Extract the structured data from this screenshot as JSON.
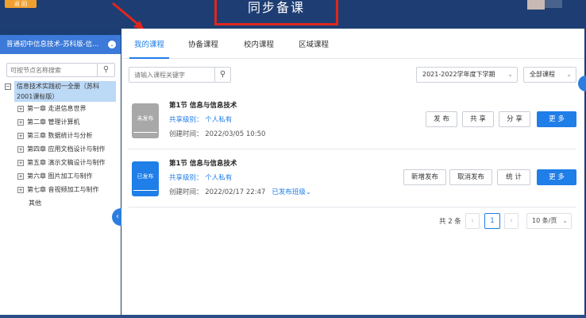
{
  "header": {
    "back_label": "返 回",
    "title": "同步备课",
    "colors": {
      "bar": "#1e3e73",
      "accent": "#1f7ee8",
      "highlight": "#e0261c"
    }
  },
  "sidebar": {
    "title": "普通初中信息技术-苏科版-信...",
    "search_placeholder": "可按节点名称搜索",
    "root_label": "信息技术实践初一全册（苏科2001课标版）",
    "items": [
      {
        "label": "第一章 走进信息世界"
      },
      {
        "label": "第二章 管理计算机"
      },
      {
        "label": "第三章 数据统计与分析"
      },
      {
        "label": "第四章 应用文档设计与制作"
      },
      {
        "label": "第五章 演示文稿设计与制作"
      },
      {
        "label": "第六章 图片加工与制作"
      },
      {
        "label": "第七章 音视频加工与制作"
      }
    ],
    "leaf_label": "其他"
  },
  "tabs": [
    {
      "label": "我的课程"
    },
    {
      "label": "协备课程"
    },
    {
      "label": "校内课程"
    },
    {
      "label": "区域课程"
    }
  ],
  "filters": {
    "search_placeholder": "请输入课程关键字",
    "semester": "2021-2022学年度下学期",
    "scope": "全部课程"
  },
  "courses": [
    {
      "status_tag": "未发布",
      "title": "第1节 信息与信息技术",
      "share": "共享级别：  个人私有",
      "created": "创建时间：  2022/03/05 10:50",
      "buttons": [
        "发 布",
        "共 享",
        "分 享"
      ],
      "more": "更 多"
    },
    {
      "status_tag": "已发布",
      "title": "第1节 信息与信息技术",
      "share": "共享级别：  个人私有",
      "created": "创建时间：  2022/02/17 22:47",
      "published_link": "已发布班级",
      "buttons": [
        "新增发布",
        "取消发布",
        "统 计"
      ],
      "more": "更 多"
    }
  ],
  "pagination": {
    "total": "共 2 条",
    "current_page": "1",
    "page_size": "10 条/页"
  }
}
